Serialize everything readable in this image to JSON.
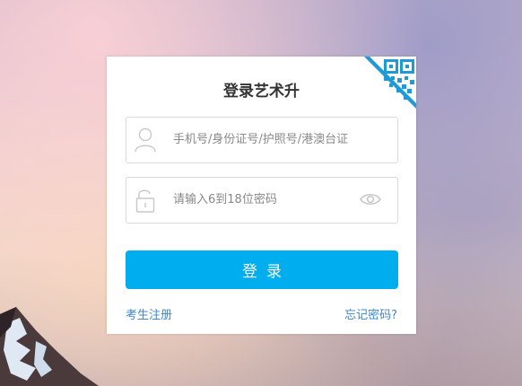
{
  "login": {
    "title": "登录艺术升",
    "username_placeholder": "手机号/身份证号/护照号/港澳台证",
    "password_placeholder": "请输入6到18位密码",
    "submit_label": "登录",
    "register_link": "考生注册",
    "forgot_link": "忘记密码?"
  },
  "icons": {
    "qr": "qr-code-icon",
    "user": "user-icon",
    "lock": "lock-icon",
    "eye": "eye-icon"
  },
  "colors": {
    "accent": "#00adef",
    "link": "#3d86d1",
    "qr": "#1e9ad6"
  }
}
